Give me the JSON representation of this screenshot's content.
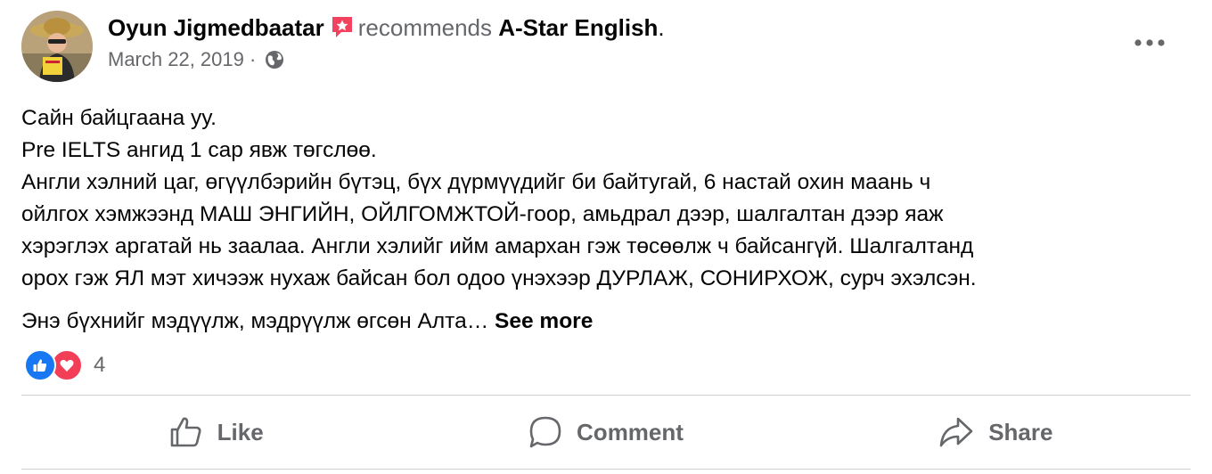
{
  "post": {
    "author": "Oyun Jigmedbaatar",
    "verb": "recommends",
    "page": "A-Star English",
    "period": ".",
    "date": "March 22, 2019",
    "separator": "·",
    "privacy_icon": "globe-icon",
    "more_icon": "more-options-icon",
    "lines": [
      "Сайн байцгаана уу.",
      "Pre IELTS ангид 1 сар явж төгслөө.",
      "Англи хэлний цаг, өгүүлбэрийн бүтэц, бүх дүрмүүдийг би байтугай, 6 настай охин маань ч",
      "ойлгох хэмжээнд МАШ ЭНГИЙН, ОЙЛГОМЖТОЙ-гоор, амьдрал дээр, шалгалтан дээр яаж",
      "хэрэглэх аргатай нь заалаа.  Англи хэлийг ийм амархан гэж төсөөлж ч байсангүй. Шалгалтанд",
      "орох гэж ЯЛ мэт хичээж нухаж байсан бол одоо үнэхээр ДУРЛАЖ, СОНИРХОЖ, сурч эхэлсэн."
    ],
    "truncated_line": "Энэ бүхнийг мэдүүлж, мэдрүүлж өгсөн Алта…",
    "see_more": "See more",
    "reactions": {
      "icons": [
        "like-reaction-icon",
        "love-reaction-icon"
      ],
      "count": "4"
    },
    "actions": {
      "like": "Like",
      "comment": "Comment",
      "share": "Share"
    },
    "colors": {
      "text": "#050505",
      "secondary": "#65676b",
      "like_blue": "#1877f2",
      "love_red": "#f33e58",
      "recommend_red": "#f3425f",
      "divider": "#ced0d4"
    }
  }
}
